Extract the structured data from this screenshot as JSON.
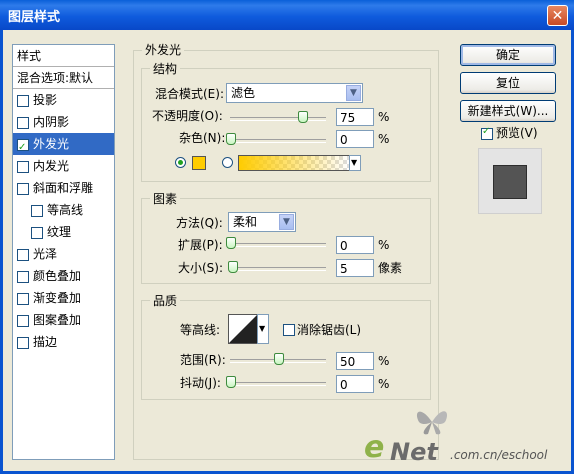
{
  "window": {
    "title": "图层样式"
  },
  "style_list": {
    "header": "样式",
    "blend_item": "混合选项:默认",
    "items": [
      {
        "label": "投影",
        "checked": false,
        "indent": 0
      },
      {
        "label": "内阴影",
        "checked": false,
        "indent": 0
      },
      {
        "label": "外发光",
        "checked": true,
        "indent": 0,
        "selected": true
      },
      {
        "label": "内发光",
        "checked": false,
        "indent": 0
      },
      {
        "label": "斜面和浮雕",
        "checked": false,
        "indent": 0
      },
      {
        "label": "等高线",
        "checked": false,
        "indent": 1
      },
      {
        "label": "纹理",
        "checked": false,
        "indent": 1
      },
      {
        "label": "光泽",
        "checked": false,
        "indent": 0
      },
      {
        "label": "颜色叠加",
        "checked": false,
        "indent": 0
      },
      {
        "label": "渐变叠加",
        "checked": false,
        "indent": 0
      },
      {
        "label": "图案叠加",
        "checked": false,
        "indent": 0
      },
      {
        "label": "描边",
        "checked": false,
        "indent": 0
      }
    ]
  },
  "outer_glow": {
    "title": "外发光",
    "structure": {
      "title": "结构",
      "blend_mode_label": "混合模式(E):",
      "blend_mode_value": "滤色",
      "opacity_label": "不透明度(O):",
      "opacity_value": "75",
      "opacity_fraction": 0.75,
      "noise_label": "杂色(N):",
      "noise_value": "0",
      "noise_fraction": 0.0,
      "percent": "%",
      "glow_color": "#FFCC00"
    },
    "elements": {
      "title": "图素",
      "technique_label": "方法(Q):",
      "technique_value": "柔和",
      "spread_label": "扩展(P):",
      "spread_value": "0",
      "spread_fraction": 0.0,
      "size_label": "大小(S):",
      "size_value": "5",
      "size_fraction": 0.02,
      "percent": "%",
      "size_unit": "像素"
    },
    "quality": {
      "title": "品质",
      "contour_label": "等高线:",
      "anti_alias_label": "消除锯齿(L)",
      "range_label": "范围(R):",
      "range_value": "50",
      "range_fraction": 0.5,
      "jitter_label": "抖动(J):",
      "jitter_value": "0",
      "jitter_fraction": 0.0,
      "percent": "%"
    }
  },
  "buttons": {
    "ok": "确定",
    "reset": "复位",
    "new_style": "新建样式(W)...",
    "preview_label": "预览(V)",
    "preview_checked": true
  },
  "watermark": {
    "e": "e",
    "net": "Net",
    "rest": ".com.cn/eschool"
  }
}
